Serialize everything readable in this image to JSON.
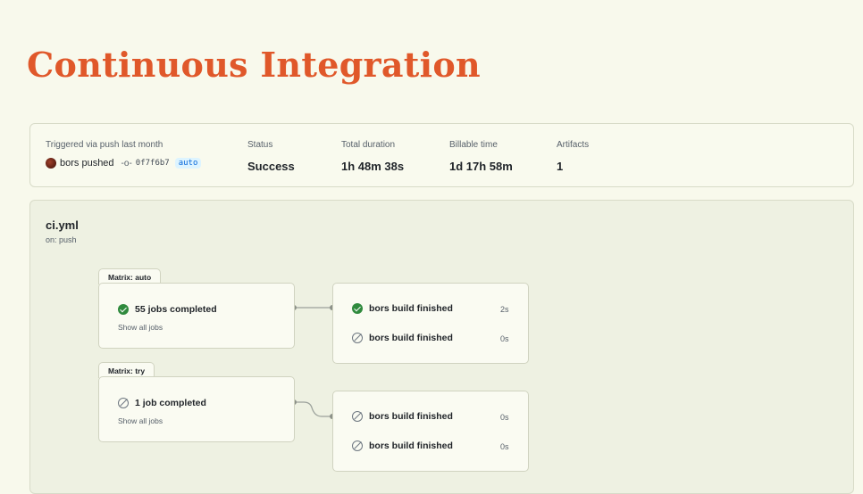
{
  "title": "Continuous Integration",
  "summary": {
    "trigger_label": "Triggered via push last month",
    "actor_text": "bors pushed",
    "commit_sha": "0f7f6b7",
    "branch": "auto",
    "status_label": "Status",
    "status_value": "Success",
    "duration_label": "Total duration",
    "duration_value": "1h 48m 38s",
    "billable_label": "Billable time",
    "billable_value": "1d 17h 58m",
    "artifacts_label": "Artifacts",
    "artifacts_value": "1"
  },
  "workflow": {
    "name": "ci.yml",
    "trigger": "on: push",
    "matrices": [
      {
        "tab_label": "Matrix: auto",
        "status": "success",
        "jobs_text": "55 jobs completed",
        "show_all": "Show all jobs",
        "downstream": [
          {
            "label": "bors build finished",
            "status": "success",
            "duration": "2s"
          },
          {
            "label": "bors build finished",
            "status": "skipped",
            "duration": "0s"
          }
        ]
      },
      {
        "tab_label": "Matrix: try",
        "status": "skipped",
        "jobs_text": "1 job completed",
        "show_all": "Show all jobs",
        "downstream": [
          {
            "label": "bors build finished",
            "status": "skipped",
            "duration": "0s"
          },
          {
            "label": "bors build finished",
            "status": "skipped",
            "duration": "0s"
          }
        ]
      }
    ]
  },
  "colors": {
    "title": "#e0582a",
    "background": "#f8f9ec",
    "success": "#2f8a3d",
    "branch_badge_bg": "#ddf4ff",
    "branch_badge_text": "#0969da"
  }
}
